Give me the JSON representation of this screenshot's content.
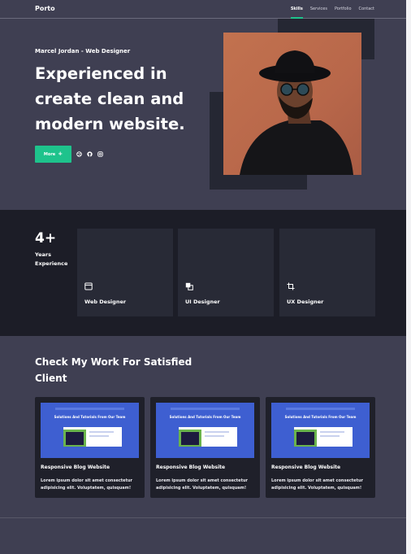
{
  "nav": {
    "brand": "Porto",
    "links": [
      "Skills",
      "Services",
      "Portfolio",
      "Contact"
    ],
    "active": "Skills"
  },
  "hero": {
    "subtitle": "Marcel Jordan - Web Designer",
    "title": "Experienced in create clean and modern website.",
    "more_label": "More",
    "socials": [
      "dribbble-icon",
      "github-icon",
      "instagram-icon"
    ]
  },
  "stats": {
    "experience_number": "4+",
    "experience_label": "Years Experience",
    "skills": [
      {
        "label": "Web Designer",
        "icon": "browser-window-icon"
      },
      {
        "label": "UI Designer",
        "icon": "layers-icon"
      },
      {
        "label": "UX Designer",
        "icon": "crop-icon"
      }
    ]
  },
  "work": {
    "title": "Check My Work For Satisfied Client",
    "projects": [
      {
        "title": "Responsive Blog Website",
        "description": "Lorem ipsum dolor sit amet consectetur adipisicing elit. Voluptatem, quisquam!",
        "thumb_heading": "Solutions And Tutorials From Our Team"
      },
      {
        "title": "Responsive Blog Website",
        "description": "Lorem ipsum dolor sit amet consectetur adipisicing elit. Voluptatem, quisquam!",
        "thumb_heading": "Solutions And Tutorials From Our Team"
      },
      {
        "title": "Responsive Blog Website",
        "description": "Lorem ipsum dolor sit amet consectetur adipisicing elit. Voluptatem, quisquam!",
        "thumb_heading": "Solutions And Tutorials From Our Team"
      }
    ]
  },
  "colors": {
    "accent": "#1ec38c",
    "background": "#3f3f52",
    "dark_section": "#1c1d27",
    "card": "#282a36",
    "thumb_blue": "#3e5fd1"
  }
}
